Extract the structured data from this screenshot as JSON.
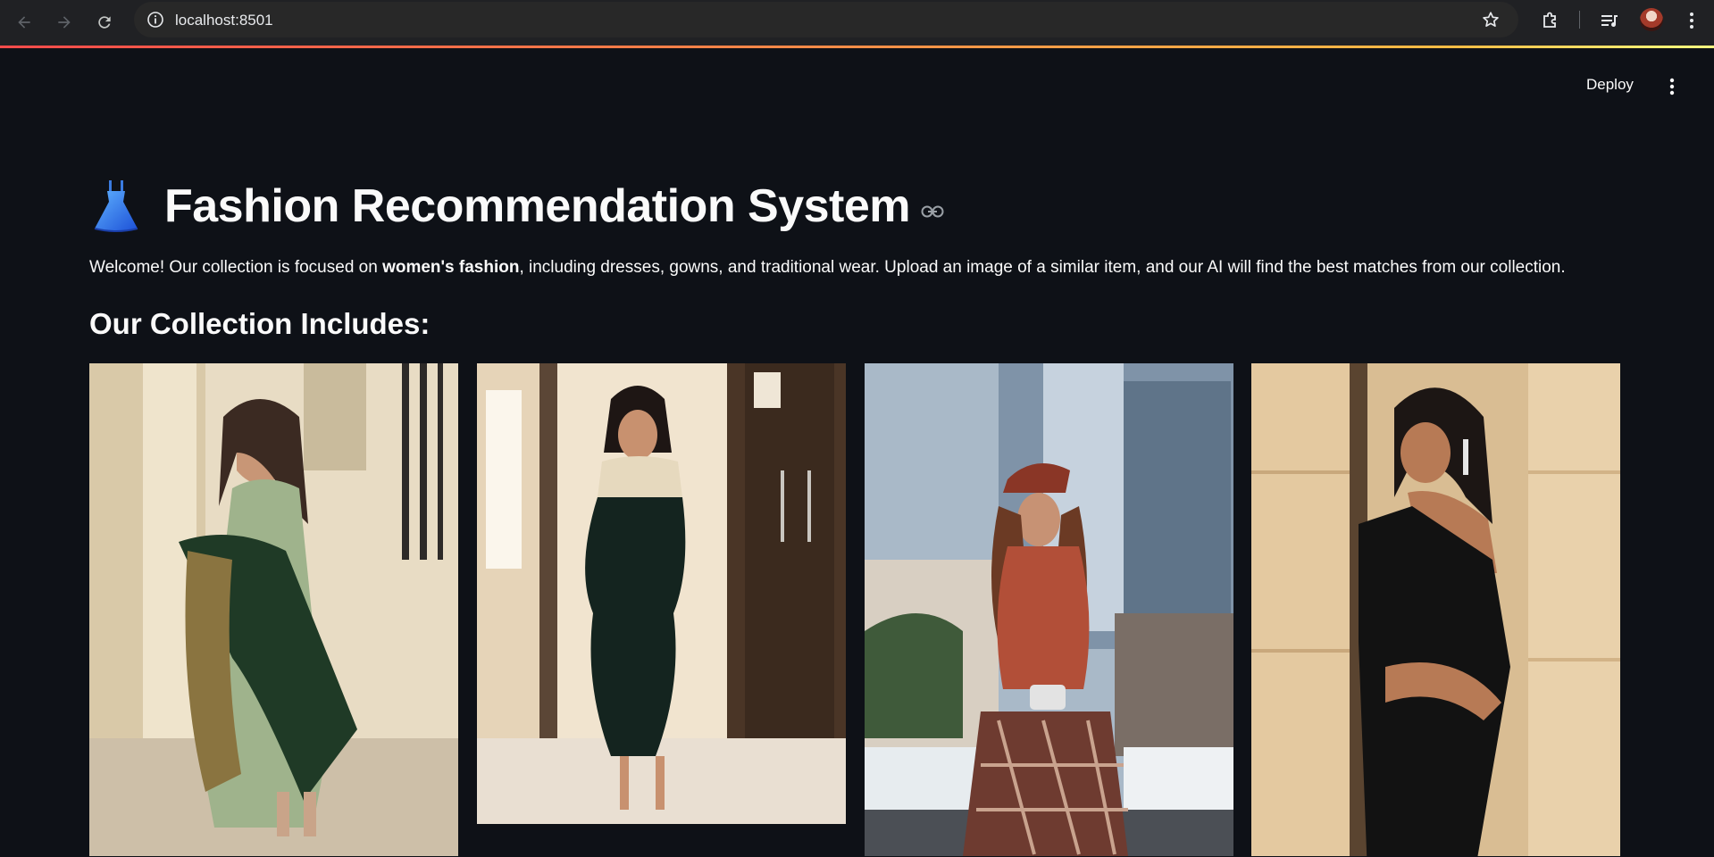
{
  "browser": {
    "url": "localhost:8501",
    "back_icon": "arrow-left-icon",
    "forward_icon": "arrow-right-icon",
    "reload_icon": "reload-icon",
    "bookmark_icon": "star-icon"
  },
  "header": {
    "deploy_label": "Deploy",
    "menu_icon": "more-vertical-icon"
  },
  "main": {
    "title": "Fashion Recommendation System",
    "title_icon": "dress-icon",
    "intro_prefix": "Welcome! Our collection is focused on ",
    "intro_bold": "women's fashion",
    "intro_suffix": ", including dresses, gowns, and traditional wear. Upload an image of a similar item, and our AI will find the best matches from our collection.",
    "section_title": "Our Collection Includes:"
  },
  "collection": [
    {
      "alt": "Green salwar suit with dupatta"
    },
    {
      "alt": "Black bodycon dress"
    },
    {
      "alt": "Rust turtleneck with plaid skirt"
    },
    {
      "alt": "Black one-shoulder jumpsuit"
    }
  ],
  "colors": {
    "app_background": "#0e1117",
    "browser_chrome": "#202124",
    "accent_gradient_start": "#ff4b4b",
    "accent_gradient_end": "#fffd80",
    "text": "#fafafa"
  }
}
